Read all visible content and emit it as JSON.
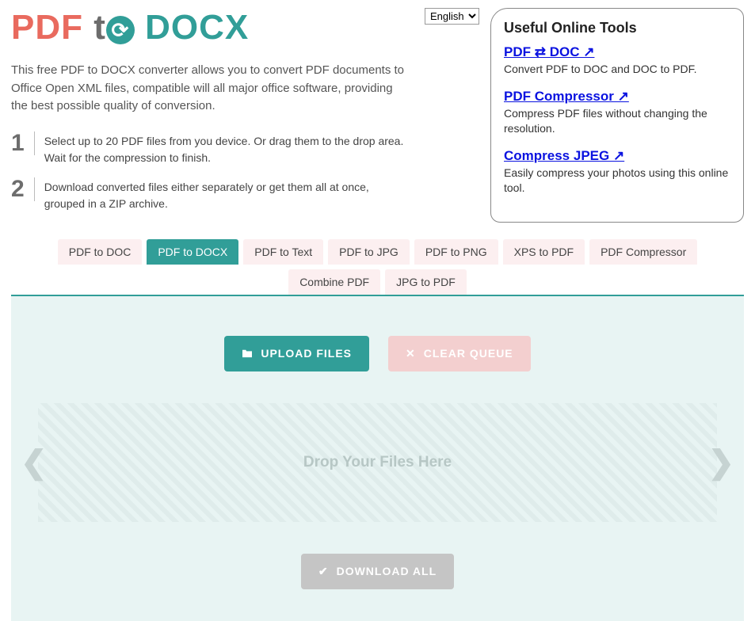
{
  "logo": {
    "part1": "PDF",
    "part2": "t",
    "part3": "DOCX"
  },
  "language": {
    "selected": "English"
  },
  "description": "This free PDF to DOCX converter allows you to convert PDF documents to Office Open XML files, compatible will all major office software, providing the best possible quality of conversion.",
  "steps": [
    {
      "num": "1",
      "text": "Select up to 20 PDF files from you device. Or drag them to the drop area. Wait for the compression to finish."
    },
    {
      "num": "2",
      "text": "Download converted files either separately or get them all at once, grouped in a ZIP archive."
    }
  ],
  "sidebar": {
    "title": "Useful Online Tools",
    "tools": [
      {
        "link": "PDF ⇄ DOC ↗",
        "desc": "Convert PDF to DOC and DOC to PDF."
      },
      {
        "link": "PDF Compressor ↗",
        "desc": "Compress PDF files without changing the resolution."
      },
      {
        "link": "Compress JPEG ↗",
        "desc": "Easily compress your photos using this online tool."
      }
    ]
  },
  "tabs": [
    {
      "label": "PDF to DOC",
      "active": false
    },
    {
      "label": "PDF to DOCX",
      "active": true
    },
    {
      "label": "PDF to Text",
      "active": false
    },
    {
      "label": "PDF to JPG",
      "active": false
    },
    {
      "label": "PDF to PNG",
      "active": false
    },
    {
      "label": "XPS to PDF",
      "active": false
    },
    {
      "label": "PDF Compressor",
      "active": false
    },
    {
      "label": "Combine PDF",
      "active": false
    },
    {
      "label": "JPG to PDF",
      "active": false
    }
  ],
  "buttons": {
    "upload": "UPLOAD FILES",
    "clear": "CLEAR QUEUE",
    "download": "DOWNLOAD ALL"
  },
  "dropzone": {
    "message": "Drop Your Files Here"
  },
  "nav": {
    "prev": "❮",
    "next": "❯"
  }
}
